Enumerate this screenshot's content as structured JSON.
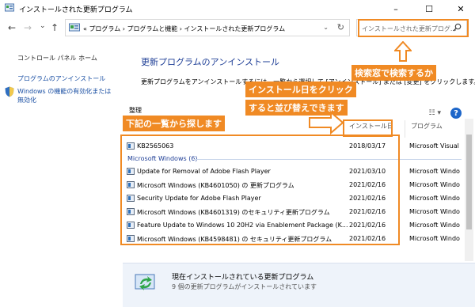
{
  "window": {
    "title": "インストールされた更新プログラム",
    "minimize": "–",
    "maximize": "☐",
    "close": "✕"
  },
  "nav": {
    "back": "←",
    "forward": "→",
    "dropdown": "⌄",
    "up": "↑",
    "address": "«  プログラム  ›  プログラムと機能  ›  インストールされた更新プログラム",
    "address_chevron": "⌄",
    "refresh": "↻",
    "search_placeholder": "インストールされた更新プログ..."
  },
  "left_pane": {
    "home_link": "コントロール パネル ホーム",
    "uninstall_link": "プログラムのアンインストール",
    "features_link_1": "Windows の機能の有効化または",
    "features_link_2": "無効化"
  },
  "main": {
    "title": "更新プログラムのアンインストール",
    "description": "更新プログラムをアンインストールするには、一覧から選択して [アンインストール] または [変更] をクリックします。",
    "organize_label": "整理",
    "view_icon": "☷ ▾",
    "help": "?"
  },
  "list": {
    "headers": {
      "date": "インストール日",
      "program": "プログラム"
    },
    "top_rows": [
      {
        "name": "KB2565063",
        "date": "2018/03/17",
        "program": "Microsoft Visual"
      }
    ],
    "group_label": "Microsoft Windows (6)",
    "rows": [
      {
        "name": "Update for Removal of Adobe Flash Player",
        "date": "2021/03/10",
        "program": "Microsoft Windo"
      },
      {
        "name": "Microsoft Windows (KB4601050) の 更新プログラム",
        "date": "2021/02/16",
        "program": "Microsoft Windo"
      },
      {
        "name": "Security Update for Adobe Flash Player",
        "date": "2021/02/16",
        "program": "Microsoft Windo"
      },
      {
        "name": "Microsoft Windows (KB4601319) のセキュリティ更新プログラム",
        "date": "2021/02/16",
        "program": "Microsoft Windo"
      },
      {
        "name": "Feature Update to Windows 10 20H2 via Enablement Package (K...",
        "date": "2021/02/16",
        "program": "Microsoft Windo"
      },
      {
        "name": "Microsoft Windows (KB4598481) の セキュリティ更新プログラム",
        "date": "2021/02/16",
        "program": "Microsoft Windo"
      }
    ]
  },
  "details": {
    "title": "現在インストールされている更新プログラム",
    "subtitle": "9 個の更新プログラムがインストールされています"
  },
  "annotations": {
    "search_note": "検索窓で検索するか",
    "date_note_1": "インストール日をクリック",
    "date_note_2": "すると並び替えできます",
    "list_note": "下記の一覧から探します",
    "color": "#f08a24"
  }
}
